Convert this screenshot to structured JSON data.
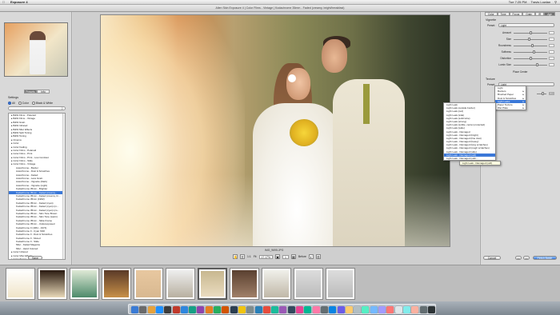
{
  "menubar": {
    "app": "Exposure 4",
    "right": [
      "Tue 7:25 PM",
      "Travis Lowlan"
    ]
  },
  "titlebar": {
    "title": "Alien Skin Exposure 4 | Color Films - Vintage | Kodachrome 35mm - Faded (creamy, bright/breakfast)"
  },
  "left": {
    "tabs": [
      "Presets",
      "Info"
    ],
    "settings_label": "Settings",
    "filters": [
      "All",
      "Color",
      "Black & White"
    ],
    "presets": [
      {
        "label": "B&W Films - Polaroid",
        "child": false
      },
      {
        "label": "B&W Films - Vintage",
        "child": false
      },
      {
        "label": "B&W Grain",
        "child": false
      },
      {
        "label": "B&W Infrared",
        "child": false
      },
      {
        "label": "B&W Misc Effects",
        "child": false
      },
      {
        "label": "B&W Split Toning",
        "child": false
      },
      {
        "label": "B&W Toning",
        "child": false
      },
      {
        "label": "Cinema",
        "child": false
      },
      {
        "label": "Color",
        "child": false
      },
      {
        "label": "Color Fading",
        "child": false
      },
      {
        "label": "Color Films - Polaroid",
        "child": false
      },
      {
        "label": "Color Films - Print",
        "child": false
      },
      {
        "label": "Color Films - Print - Low Contrast",
        "child": false
      },
      {
        "label": "Color Films - Slide",
        "child": false
      },
      {
        "label": "Color Films - Vintage",
        "child": false
      },
      {
        "label": "Autochrome - Border",
        "child": true
      },
      {
        "label": "Autochrome - Dust & Scratches",
        "child": true
      },
      {
        "label": "Autochrome - Faded",
        "child": true
      },
      {
        "label": "Autochrome - Less Grain",
        "child": true
      },
      {
        "label": "Autochrome - Vignette (Dark)",
        "child": true
      },
      {
        "label": "Autochrome - Vignette (Light)",
        "child": true
      },
      {
        "label": "Kodachrome 35mm - Brighter",
        "child": true
      },
      {
        "label": "Kodachrome 35mm - Faded (creamy...",
        "child": true
      },
      {
        "label": "Kodachrome 35mm - Faded (creamy, br...",
        "child": true
      },
      {
        "label": "Kodachrome 35mm (1962)",
        "child": true
      },
      {
        "label": "Kodachrome 35mm - Faded (cyan)",
        "child": true
      },
      {
        "label": "Kodachrome 35mm - Faded (cyan) (m...",
        "child": true
      },
      {
        "label": "Kodachrome 35mm - Faded (cyan) (co...",
        "child": true
      },
      {
        "label": "Kodachrome 35mm - Skin Tone Brown",
        "child": true
      },
      {
        "label": "Kodachrome 35mm - Skin Tone (warm)",
        "child": true
      },
      {
        "label": "Kodachrome 35mm - Slide Frame",
        "child": true
      },
      {
        "label": "Kodachrome 35mm - Underexposed",
        "child": true
      },
      {
        "label": "Kodachrome II (1961 - 1974)",
        "child": true
      },
      {
        "label": "Kodachrome II - Cyan Shift",
        "child": true
      },
      {
        "label": "Kodachrome II - Dust & Scratches",
        "child": true
      },
      {
        "label": "Kodachrome II - Muted",
        "child": true
      },
      {
        "label": "Kodachrome II - Slide",
        "child": true
      },
      {
        "label": "Misc - Faded Magenta",
        "child": true
      },
      {
        "label": "Misc - Hand Colored",
        "child": true
      },
      {
        "label": "Color Infrared",
        "child": false
      },
      {
        "label": "Color Misc Effects",
        "child": false
      },
      {
        "label": "Color Toning",
        "child": false
      }
    ],
    "selected_index": 22,
    "save_label": "Save"
  },
  "center": {
    "filename": "IMG_9695.JPG",
    "zoom": {
      "value": "17.17%",
      "ratio": "1:1",
      "fit": "Fit",
      "page": "1",
      "before_label": "Before"
    },
    "cancel_label": "Cancel",
    "finish_label": "Finish Batch"
  },
  "right": {
    "tabs": [
      "Color",
      "Tone",
      "Focus",
      "Grain",
      "IR",
      "Age"
    ],
    "active_tab": "Age",
    "vignette": {
      "title": "Vignette",
      "preset_label": "Preset:",
      "preset_value": "Light",
      "sliders": [
        {
          "label": "Amount",
          "value": "0",
          "pos": 0.5
        },
        {
          "label": "Size",
          "value": "0",
          "pos": 0.45
        },
        {
          "label": "Roundness",
          "value": "0",
          "pos": 0.55
        },
        {
          "label": "Softness",
          "value": "0",
          "pos": 0.6
        },
        {
          "label": "Distortion",
          "value": "0",
          "pos": 0.5
        },
        {
          "label": "Lumin Size",
          "value": "0",
          "pos": 0.7
        }
      ],
      "place_center": "Place Center"
    },
    "texture": {
      "title": "Texture",
      "preset_label": "Preset:",
      "preset_value": "Light",
      "amount_value": "100"
    }
  },
  "texture_menu": {
    "items": [
      {
        "label": "Light",
        "arrow": false
      },
      {
        "label": "Borders",
        "arrow": true
      },
      {
        "label": "Brushed Paper",
        "arrow": true
      },
      {
        "label": "Dust & Scratches",
        "arrow": true
      },
      {
        "label": "Light Leaks",
        "arrow": true,
        "highlight": true
      },
      {
        "label": "Paper Texture",
        "arrow": true
      },
      {
        "label": "Wet Plate",
        "arrow": true
      }
    ]
  },
  "leaks_menu": {
    "items": [
      {
        "label": "Light Leak"
      },
      {
        "label": "Light Leak (outside border)"
      },
      {
        "label": "Light Leak (red)"
      },
      {
        "label": "Light Leak (side)"
      },
      {
        "label": "Light Leak (solid tube)"
      },
      {
        "label": "Light Leak (strong)"
      },
      {
        "label": "Light Leak (subtle, center protected)"
      },
      {
        "label": "Light Leak (wide)"
      },
      {
        "label": "Light Leak - Damaged"
      },
      {
        "label": "Light Leak - Damaged (bright)"
      },
      {
        "label": "Light Leak - Damaged (fine dust)"
      },
      {
        "label": "Light Leak - Damaged (heavy)"
      },
      {
        "label": "Light Leak - Damaged (long scratches)"
      },
      {
        "label": "Light Leak - Damaged (rough scratches)"
      },
      {
        "label": "Light Leak - Damaged (side)"
      },
      {
        "label": "Light Leak - Damaged (soft)",
        "highlight": true
      },
      {
        "label": "Light Leak - Damaged (subt..."
      }
    ],
    "tooltip": "Light Leak - Damaged (soft)"
  },
  "strip": {
    "count": 11,
    "selected": 6
  },
  "colors": {
    "accent": "#3b78d8",
    "panel": "#d9d9d9",
    "strip": "#bdbdbd"
  }
}
